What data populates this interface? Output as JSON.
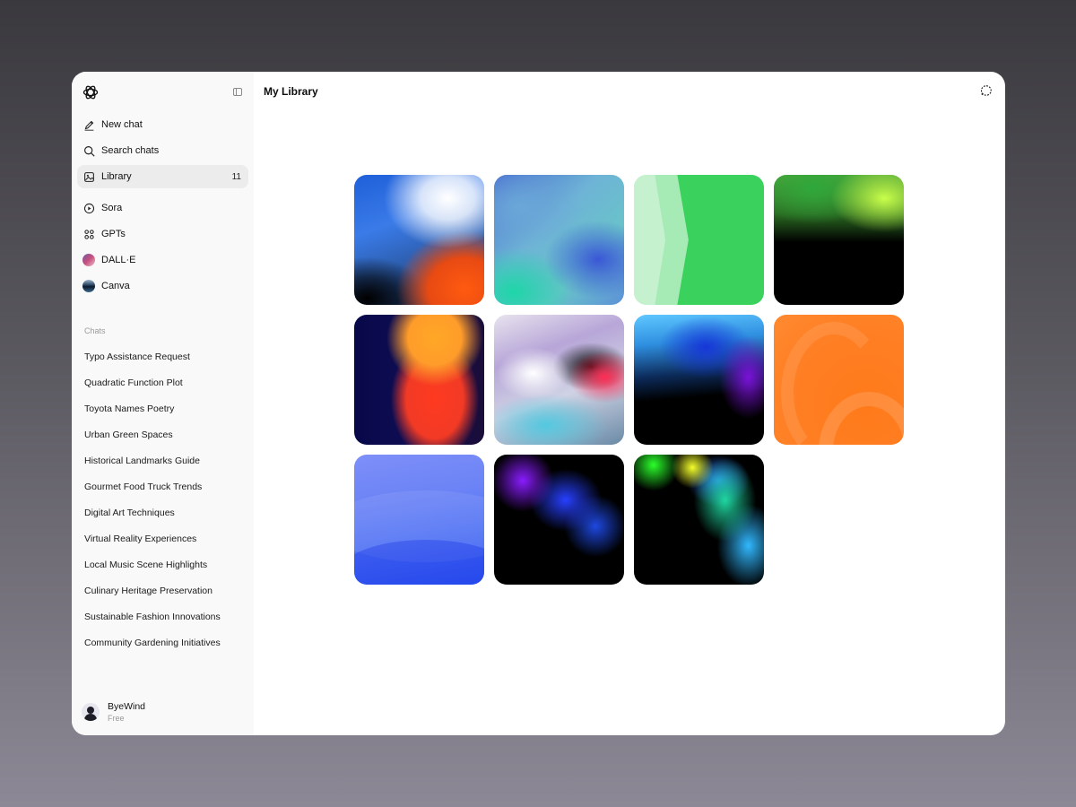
{
  "sidebar": {
    "nav": [
      {
        "label": "New chat",
        "icon": "pencil-icon"
      },
      {
        "label": "Search chats",
        "icon": "search-icon"
      },
      {
        "label": "Library",
        "icon": "image-icon",
        "count": "11",
        "active": true
      }
    ],
    "apps": [
      {
        "label": "Sora",
        "icon": "play-circle-icon"
      },
      {
        "label": "GPTs",
        "icon": "grid-icon"
      },
      {
        "label": "DALL·E",
        "icon": "dalle-avatar-icon"
      },
      {
        "label": "Canva",
        "icon": "canva-avatar-icon"
      }
    ],
    "chats_heading": "Chats",
    "chats": [
      "Typo Assistance Request",
      "Quadratic Function Plot",
      "Toyota Names Poetry",
      "Urban Green Spaces",
      "Historical Landmarks Guide",
      "Gourmet Food Truck Trends",
      "Digital Art Techniques",
      "Virtual Reality Experiences",
      "Local Music Scene Highlights",
      "Culinary Heritage Preservation",
      "Sustainable Fashion Innovations",
      "Community Gardening Initiatives"
    ],
    "user": {
      "name": "ByeWind",
      "plan": "Free"
    }
  },
  "main": {
    "title": "My Library",
    "images": [
      {
        "name": "blue-white-orange-gradient"
      },
      {
        "name": "blue-teal-gradient"
      },
      {
        "name": "green-chevron"
      },
      {
        "name": "green-lime-black"
      },
      {
        "name": "navy-orange-red"
      },
      {
        "name": "white-purple-blur"
      },
      {
        "name": "sky-blue-purple-black"
      },
      {
        "name": "orange-arcs"
      },
      {
        "name": "blue-waves"
      },
      {
        "name": "purple-blue-black"
      },
      {
        "name": "green-yellow-cyan-black"
      }
    ]
  },
  "colors": {
    "sidebar_bg": "#f9f9f9",
    "active_item_bg": "#ececec",
    "background_top": "#3a393e",
    "background_bottom": "#8c8895"
  }
}
